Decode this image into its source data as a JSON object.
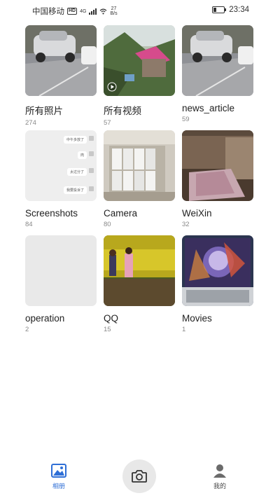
{
  "status_bar": {
    "carrier": "中国移动",
    "hd_badge": "HD",
    "network": "4G",
    "speed_value": "27",
    "speed_unit": "B/s",
    "time": "23:34",
    "icons": [
      "signal-icon",
      "wifi-icon",
      "battery-icon"
    ]
  },
  "albums": [
    {
      "name": "所有照片",
      "count": "274",
      "thumb": "car-street-photo"
    },
    {
      "name": "所有视频",
      "count": "57",
      "thumb": "mountain-house-video"
    },
    {
      "name": "news_article",
      "count": "59",
      "thumb": "car-street-photo"
    },
    {
      "name": "Screenshots",
      "count": "84",
      "thumb": "chat-screenshot"
    },
    {
      "name": "Camera",
      "count": "80",
      "thumb": "shelf-boxes-photo"
    },
    {
      "name": "WeiXin",
      "count": "32",
      "thumb": "brick-room-bed-photo"
    },
    {
      "name": "operation",
      "count": "2",
      "thumb": "blank-thumbnail"
    },
    {
      "name": "QQ",
      "count": "15",
      "thumb": "kids-flower-field-photo"
    },
    {
      "name": "Movies",
      "count": "1",
      "thumb": "cartoon-laptop-photo"
    }
  ],
  "screenshot_chat": {
    "messages": [
      "中午多放了",
      "肉",
      "太过分了",
      "我要投诉了"
    ]
  },
  "bottom_nav": {
    "albums_label": "相册",
    "me_label": "我的"
  },
  "colors": {
    "accent": "#2f6fd6",
    "thumb_placeholder": "#e9e9e9",
    "count_text": "#888888"
  }
}
